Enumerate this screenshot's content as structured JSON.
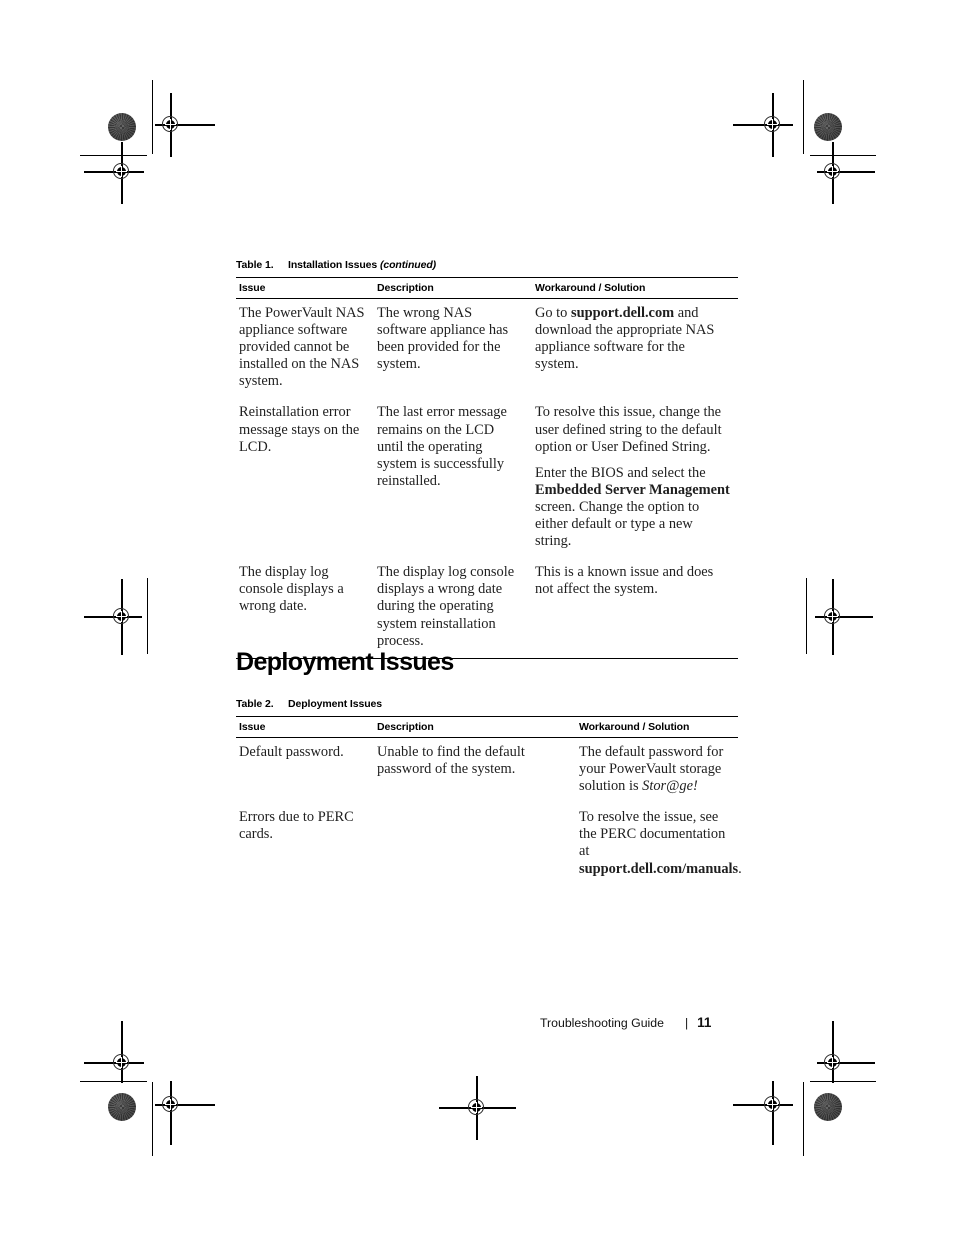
{
  "document": {
    "footer": {
      "guide_title": "Troubleshooting Guide",
      "separator": "|",
      "page_number": "11"
    }
  },
  "table1": {
    "caption_label": "Table 1.",
    "caption_title": "Installation Issues",
    "caption_continued": "(continued)",
    "columns": [
      "Issue",
      "Description",
      "Workaround / Solution"
    ],
    "rows": [
      {
        "issue": "The PowerVault NAS appliance software provided cannot be installed on the NAS system.",
        "description": "The wrong NAS software appliance has been provided for the system.",
        "solution_pre": "Go to ",
        "solution_bold": "support.dell.com",
        "solution_post": " and download the appropriate NAS appliance software for the system."
      },
      {
        "issue": "Reinstallation error message stays on the LCD.",
        "description": "The last error message remains on the LCD until the operating system is successfully reinstalled.",
        "solution_p1": "To resolve this issue, change the user defined string to the default option or User Defined String.",
        "solution_p2_pre": "Enter the BIOS and select the ",
        "solution_p2_bold": "Embedded Server Management",
        "solution_p2_post": " screen. Change the option to either default or type a new string."
      },
      {
        "issue": "The display log console displays a wrong date.",
        "description": "The display log console displays a wrong date during the operating system reinstallation process.",
        "solution": "This is a known issue and does not affect the system."
      }
    ]
  },
  "section_heading": "Deployment Issues",
  "table2": {
    "caption_label": "Table 2.",
    "caption_title": "Deployment Issues",
    "columns": [
      "Issue",
      "Description",
      "Workaround / Solution"
    ],
    "rows": [
      {
        "issue": "Default password.",
        "description": "Unable to find the default password of the system.",
        "solution_pre": "The default password for your PowerVault storage solution is ",
        "solution_italic": "Stor@ge!",
        "solution_post": ""
      },
      {
        "issue": "Errors due to PERC cards.",
        "description": "",
        "solution_pre": "To resolve the issue, see the PERC documentation at ",
        "solution_bold": "support.dell.com/manuals",
        "solution_post": "."
      }
    ]
  }
}
